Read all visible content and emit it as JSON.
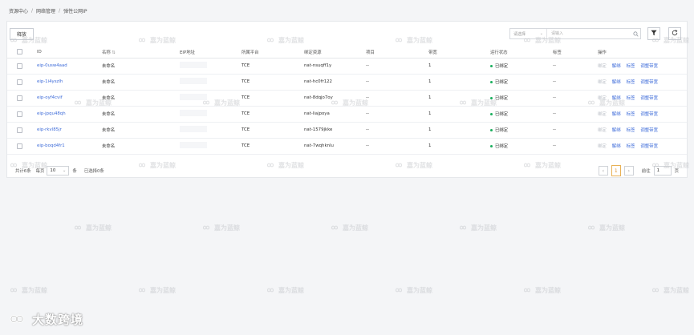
{
  "breadcrumb": {
    "items": [
      "资源中心",
      "网络管理"
    ],
    "separator": "/",
    "current": "弹性公网IP"
  },
  "toolbar": {
    "release_label": "释放",
    "search_field_placeholder": "请选择",
    "search_placeholder": "请输入",
    "icons": [
      "search-icon",
      "filter-icon",
      "refresh-icon"
    ]
  },
  "table": {
    "columns": [
      "ID",
      "名称",
      "EIP地址",
      "所属平台",
      "绑定资源",
      "项目",
      "带宽",
      "运行状态",
      "标签",
      "操作"
    ],
    "rows": [
      {
        "id": "eip-0usw4aad",
        "name": "未命名",
        "eip": "",
        "platform": "TCE",
        "resource": "nat-nsuqff1y",
        "project": "--",
        "bandwidth": "1",
        "status": "已绑定",
        "tags": "--"
      },
      {
        "id": "eip-1i4yszlh",
        "name": "未命名",
        "eip": "",
        "platform": "TCE",
        "resource": "nat-hc0fr122",
        "project": "--",
        "bandwidth": "1",
        "status": "已绑定",
        "tags": "--"
      },
      {
        "id": "eip-oyf4cvif",
        "name": "未命名",
        "eip": "",
        "platform": "TCE",
        "resource": "nat-8dqjo7oy",
        "project": "--",
        "bandwidth": "1",
        "status": "已绑定",
        "tags": "--"
      },
      {
        "id": "eip-jpqu48qh",
        "name": "未命名",
        "eip": "",
        "platform": "TCE",
        "resource": "nat-liajpoya",
        "project": "--",
        "bandwidth": "1",
        "status": "已绑定",
        "tags": "--"
      },
      {
        "id": "eip-rkvl85jr",
        "name": "未命名",
        "eip": "",
        "platform": "TCE",
        "resource": "nat-1579jkke",
        "project": "--",
        "bandwidth": "1",
        "status": "已绑定",
        "tags": "--"
      },
      {
        "id": "eip-boqd4fr1",
        "name": "未命名",
        "eip": "",
        "platform": "TCE",
        "resource": "nat-7wqhknlu",
        "project": "--",
        "bandwidth": "1",
        "status": "已绑定",
        "tags": "--"
      }
    ],
    "actions": [
      "绑定",
      "解绑",
      "标签",
      "调整带宽"
    ]
  },
  "pagination": {
    "total_text": "共计6条",
    "per_page_label": "每页",
    "page_size": "10",
    "unit": "条",
    "selected_text": "已选择0条",
    "current_page": "1",
    "goto_label": "前往",
    "goto_value": "1",
    "goto_unit": "页"
  },
  "watermark": {
    "text": "嘉为蓝鲸"
  },
  "corner_logo": {
    "text": "大数跨境"
  },
  "colors": {
    "link": "#3d6bd9",
    "status_bound": "#1aaf5d",
    "page_active": "#e0922c"
  }
}
